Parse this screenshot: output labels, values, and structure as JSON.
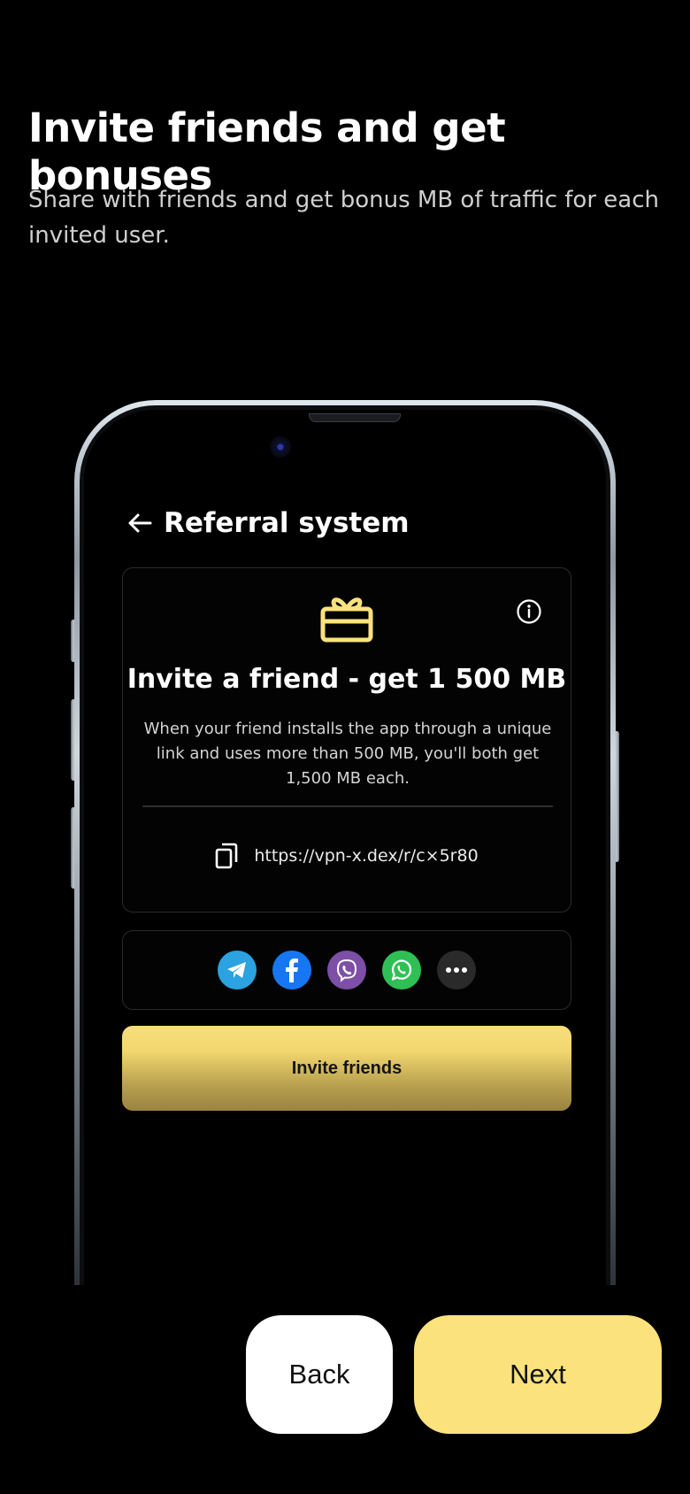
{
  "onboarding": {
    "title": "Invite friends and get bonuses",
    "subtitle": "Share with friends and get bonus MB of traffic for each invited user."
  },
  "phone": {
    "nav": {
      "back_icon": "arrow-left-icon",
      "title": "Referral system"
    },
    "referral_card": {
      "gift_icon": "gift-icon",
      "info_icon": "info-icon",
      "title": "Invite a friend - get 1 500 MB",
      "description": "When your friend installs the app through a unique link and uses more than 500 MB, you'll both get 1,500 MB each.",
      "copy_icon": "copy-icon",
      "link": "https://vpn-x.dex/r/c×5r80"
    },
    "share": [
      {
        "name": "telegram",
        "icon": "telegram-icon",
        "color": "#2aa3e0"
      },
      {
        "name": "facebook",
        "icon": "facebook-icon",
        "color": "#1777f2"
      },
      {
        "name": "viber",
        "icon": "viber-icon",
        "color": "#7d4fa6"
      },
      {
        "name": "whatsapp",
        "icon": "whatsapp-icon",
        "color": "#2fc055"
      },
      {
        "name": "more",
        "icon": "more-icon",
        "color": "#2a2a2a"
      }
    ],
    "invite_button_label": "Invite friends"
  },
  "footer": {
    "back_label": "Back",
    "next_label": "Next"
  },
  "colors": {
    "accent": "#fbe27c",
    "background": "#000000"
  }
}
